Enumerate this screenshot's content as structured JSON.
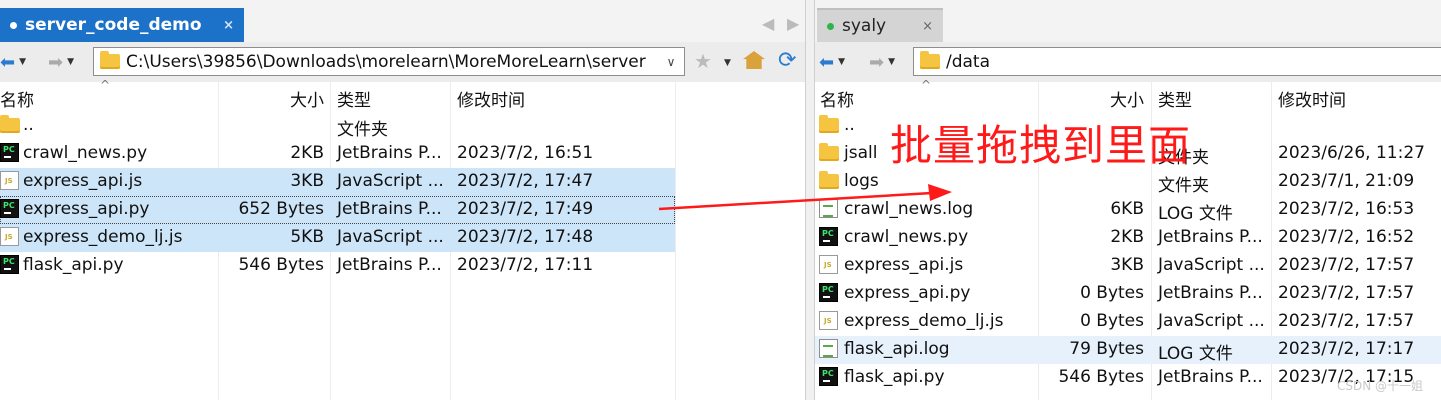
{
  "left": {
    "tab": {
      "title": "server_code_demo",
      "close": "×"
    },
    "tab_nav": {
      "prev": "◀",
      "next": "▶"
    },
    "path": "C:\\Users\\39856\\Downloads\\morelearn\\MoreMoreLearn\\server",
    "headers": {
      "name": "名称",
      "size": "大小",
      "type": "类型",
      "modified": "修改时间"
    },
    "files": [
      {
        "name": "..",
        "size": "",
        "type": "文件夹",
        "modified": "",
        "icon": "folder-icon"
      },
      {
        "name": "crawl_news.py",
        "size": "2KB",
        "type": "JetBrains P...",
        "modified": "2023/7/2, 16:51",
        "icon": "pycharm-icon"
      },
      {
        "name": "express_api.js",
        "size": "3KB",
        "type": "JavaScript ...",
        "modified": "2023/7/2, 17:47",
        "icon": "js-file-icon"
      },
      {
        "name": "express_api.py",
        "size": "652 Bytes",
        "type": "JetBrains P...",
        "modified": "2023/7/2, 17:49",
        "icon": "pycharm-icon"
      },
      {
        "name": "express_demo_lj.js",
        "size": "5KB",
        "type": "JavaScript ...",
        "modified": "2023/7/2, 17:48",
        "icon": "js-file-icon"
      },
      {
        "name": "flask_api.py",
        "size": "546 Bytes",
        "type": "JetBrains P...",
        "modified": "2023/7/2, 17:11",
        "icon": "pycharm-icon"
      }
    ]
  },
  "right": {
    "tab": {
      "title": "syaly",
      "close": "×"
    },
    "path": "/data",
    "headers": {
      "name": "名称",
      "size": "大小",
      "type": "类型",
      "modified": "修改时间"
    },
    "files": [
      {
        "name": "..",
        "size": "",
        "type": "",
        "modified": "",
        "icon": "folder-icon"
      },
      {
        "name": "jsall",
        "size": "",
        "type": "文件夹",
        "modified": "2023/6/26, 11:27",
        "icon": "folder-icon"
      },
      {
        "name": "logs",
        "size": "",
        "type": "文件夹",
        "modified": "2023/7/1, 21:09",
        "icon": "folder-icon"
      },
      {
        "name": "crawl_news.log",
        "size": "6KB",
        "type": "LOG 文件",
        "modified": "2023/7/2, 16:53",
        "icon": "log-file-icon"
      },
      {
        "name": "crawl_news.py",
        "size": "2KB",
        "type": "JetBrains P...",
        "modified": "2023/7/2, 16:52",
        "icon": "pycharm-icon"
      },
      {
        "name": "express_api.js",
        "size": "3KB",
        "type": "JavaScript ...",
        "modified": "2023/7/2, 17:57",
        "icon": "js-file-icon"
      },
      {
        "name": "express_api.py",
        "size": "0 Bytes",
        "type": "JetBrains P...",
        "modified": "2023/7/2, 17:57",
        "icon": "pycharm-icon"
      },
      {
        "name": "express_demo_lj.js",
        "size": "0 Bytes",
        "type": "JavaScript ...",
        "modified": "2023/7/2, 17:57",
        "icon": "js-file-icon"
      },
      {
        "name": "flask_api.log",
        "size": "79 Bytes",
        "type": "LOG 文件",
        "modified": "2023/7/2, 17:17",
        "icon": "log-file-icon"
      },
      {
        "name": "flask_api.py",
        "size": "546 Bytes",
        "type": "JetBrains P...",
        "modified": "2023/7/2, 17:15",
        "icon": "pycharm-icon"
      }
    ]
  },
  "annotation": "批量拖拽到里面",
  "watermark": "CSDN @十一姐",
  "colors": {
    "accent": "#1c72c9",
    "selection": "#cde5f8",
    "annotation": "#ff1a1a",
    "connected_dot": "#2fb34a"
  }
}
